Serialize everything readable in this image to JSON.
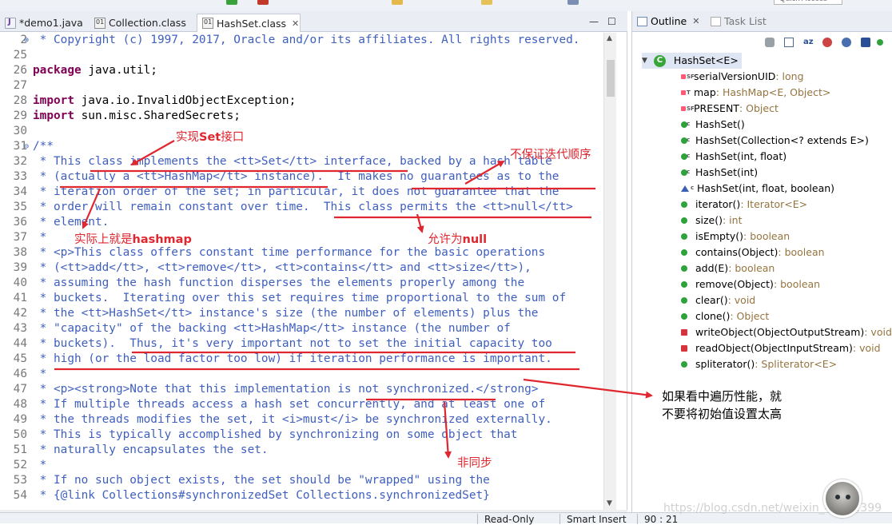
{
  "toolbar": {
    "quick_access_placeholder": "Quick Access"
  },
  "editor": {
    "tabs": [
      {
        "label": "*demo1.java",
        "icon": "java-file-icon"
      },
      {
        "label": "Collection.class",
        "icon": "class-file-icon"
      },
      {
        "label": "HashSet.class",
        "icon": "class-file-icon",
        "close": "✕"
      }
    ],
    "min_glyph": "—",
    "max_glyph": "☐"
  },
  "code_lines": [
    {
      "no": "2",
      "text": " * Copyright (c) 1997, 2017, Oracle and/or its affiliates. All rights reserved.",
      "marker": "⊕"
    },
    {
      "no": "25",
      "text": ""
    },
    {
      "no": "26",
      "kw": "package",
      "rest": " java.util;"
    },
    {
      "no": "27",
      "text": ""
    },
    {
      "no": "28",
      "kw": "import",
      "rest": " java.io.InvalidObjectException;"
    },
    {
      "no": "29",
      "kw": "import",
      "rest": " sun.misc.SharedSecrets;"
    },
    {
      "no": "30",
      "text": ""
    },
    {
      "no": "31",
      "text": "/**",
      "marker": "⊖"
    },
    {
      "no": "32",
      "text": " * This class implements the <tt>Set</tt> interface, backed by a hash table"
    },
    {
      "no": "33",
      "text": " * (actually a <tt>HashMap</tt> instance).  It makes no guarantees as to the"
    },
    {
      "no": "34",
      "text": " * iteration order of the set; in particular, it does not guarantee that the"
    },
    {
      "no": "35",
      "text": " * order will remain constant over time.  This class permits the <tt>null</tt>"
    },
    {
      "no": "36",
      "text": " * element."
    },
    {
      "no": "37",
      "text": " *"
    },
    {
      "no": "38",
      "text": " * <p>This class offers constant time performance for the basic operations"
    },
    {
      "no": "39",
      "text": " * (<tt>add</tt>, <tt>remove</tt>, <tt>contains</tt> and <tt>size</tt>),"
    },
    {
      "no": "40",
      "text": " * assuming the hash function disperses the elements properly among the"
    },
    {
      "no": "41",
      "text": " * buckets.  Iterating over this set requires time proportional to the sum of"
    },
    {
      "no": "42",
      "text": " * the <tt>HashSet</tt> instance's size (the number of elements) plus the"
    },
    {
      "no": "43",
      "text": " * \"capacity\" of the backing <tt>HashMap</tt> instance (the number of"
    },
    {
      "no": "44",
      "text": " * buckets).  Thus, it's very important not to set the initial capacity too"
    },
    {
      "no": "45",
      "text": " * high (or the load factor too low) if iteration performance is important."
    },
    {
      "no": "46",
      "text": " *"
    },
    {
      "no": "47",
      "text": " * <p><strong>Note that this implementation is not synchronized.</strong>"
    },
    {
      "no": "48",
      "text": " * If multiple threads access a hash set concurrently, and at least one of"
    },
    {
      "no": "49",
      "text": " * the threads modifies the set, it <i>must</i> be synchronized externally."
    },
    {
      "no": "50",
      "text": " * This is typically accomplished by synchronizing on some object that"
    },
    {
      "no": "51",
      "text": " * naturally encapsulates the set."
    },
    {
      "no": "52",
      "text": " *"
    },
    {
      "no": "53",
      "text": " * If no such object exists, the set should be \"wrapped\" using the"
    },
    {
      "no": "54",
      "text": " * {@link Collections#synchronizedSet Collections.synchronizedSet}"
    }
  ],
  "annotations": {
    "set_interface_a": "实现",
    "set_interface_b": "Set",
    "set_interface_c": "接口",
    "no_order": "不保证迭代顺序",
    "hashmap_a": "实际上就是",
    "hashmap_b": "hashmap",
    "null_a": "允许为",
    "null_b": "null",
    "capacity_line1": "如果看中遍历性能，就",
    "capacity_line2": "不要将初始值设置太高",
    "not_sync": "非同步"
  },
  "outline": {
    "tabs": [
      {
        "label": "Outline",
        "close": "✕"
      },
      {
        "label": "Task List"
      }
    ],
    "root": {
      "name": "HashSet<E>"
    },
    "members": [
      {
        "name": "serialVersionUID",
        "type": " : long",
        "icon": "private-static-final-field-icon"
      },
      {
        "name": "map",
        "type": " : HashMap<E, Object>",
        "icon": "private-transient-field-icon"
      },
      {
        "name": "PRESENT",
        "type": " : Object",
        "icon": "private-static-final-field-icon"
      },
      {
        "name": "HashSet()",
        "type": "",
        "icon": "public-constructor-icon"
      },
      {
        "name": "HashSet(Collection<? extends E>)",
        "type": "",
        "icon": "public-constructor-icon"
      },
      {
        "name": "HashSet(int, float)",
        "type": "",
        "icon": "public-constructor-icon"
      },
      {
        "name": "HashSet(int)",
        "type": "",
        "icon": "public-constructor-icon"
      },
      {
        "name": "HashSet(int, float, boolean)",
        "type": "",
        "icon": "package-constructor-icon"
      },
      {
        "name": "iterator()",
        "type": " : Iterator<E>",
        "icon": "public-method-icon"
      },
      {
        "name": "size()",
        "type": " : int",
        "icon": "public-method-icon"
      },
      {
        "name": "isEmpty()",
        "type": " : boolean",
        "icon": "public-method-icon"
      },
      {
        "name": "contains(Object)",
        "type": " : boolean",
        "icon": "public-method-icon"
      },
      {
        "name": "add(E)",
        "type": " : boolean",
        "icon": "public-method-icon"
      },
      {
        "name": "remove(Object)",
        "type": " : boolean",
        "icon": "public-method-icon"
      },
      {
        "name": "clear()",
        "type": " : void",
        "icon": "public-method-icon"
      },
      {
        "name": "clone()",
        "type": " : Object",
        "icon": "public-method-icon"
      },
      {
        "name": "writeObject(ObjectOutputStream)",
        "type": " : void",
        "icon": "private-method-icon"
      },
      {
        "name": "readObject(ObjectInputStream)",
        "type": " : void",
        "icon": "private-method-icon"
      },
      {
        "name": "spliterator()",
        "type": " : Spliterator<E>",
        "icon": "public-method-icon"
      }
    ]
  },
  "status": {
    "mode": "Read-Only",
    "insert": "Smart Insert",
    "position": "90 : 21"
  },
  "watermark": "https://blog.csdn.net/weixin_44861399",
  "colors": {
    "annotation": "#e0262e",
    "comment": "#3f5fbf",
    "keyword": "#7f0055"
  }
}
